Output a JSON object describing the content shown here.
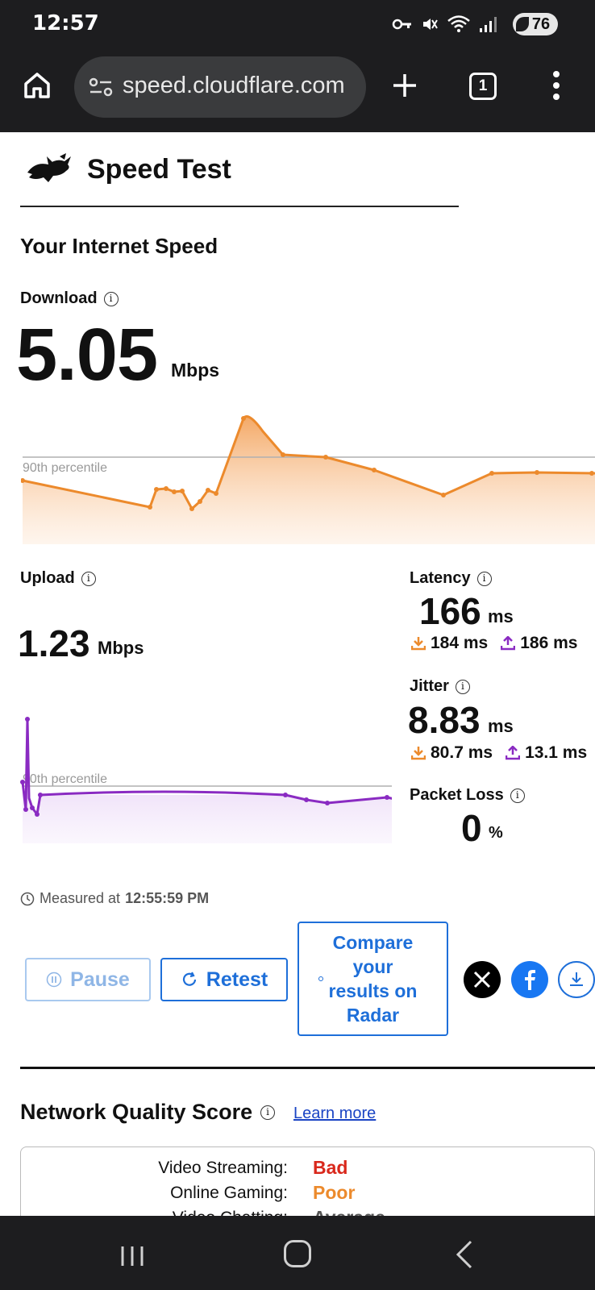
{
  "status_bar": {
    "time": "12:57",
    "battery": "76"
  },
  "browser": {
    "url": "speed.cloudflare.com",
    "tab_count": "1"
  },
  "header": {
    "title": "Speed Test"
  },
  "section_title": "Your Internet Speed",
  "download": {
    "label": "Download",
    "value": "5.05",
    "unit": "Mbps",
    "percentile_label": "90th percentile",
    "color": "#ec8a2c"
  },
  "upload": {
    "label": "Upload",
    "value": "1.23",
    "unit": "Mbps",
    "percentile_label": "90th percentile",
    "color": "#8a2bc2"
  },
  "latency": {
    "label": "Latency",
    "value": "166",
    "unit": "ms",
    "down": "184 ms",
    "up": "186 ms"
  },
  "jitter": {
    "label": "Jitter",
    "value": "8.83",
    "unit": "ms",
    "down": "80.7 ms",
    "up": "13.1 ms"
  },
  "packet_loss": {
    "label": "Packet Loss",
    "value": "0",
    "unit": "%"
  },
  "measured": {
    "prefix": "Measured at",
    "time": "12:55:59 PM"
  },
  "buttons": {
    "pause": "Pause",
    "retest": "Retest",
    "radar": [
      "Compare",
      "your",
      "results on",
      "Radar"
    ]
  },
  "network_quality": {
    "title": "Network Quality Score",
    "learn_more": "Learn more",
    "rows": [
      {
        "name": "Video Streaming:",
        "value": "Bad",
        "color": "#d9281c"
      },
      {
        "name": "Online Gaming:",
        "value": "Poor",
        "color": "#ec8a2c"
      },
      {
        "name": "Video Chatting:",
        "value": "Average",
        "color": "#555"
      }
    ]
  }
}
